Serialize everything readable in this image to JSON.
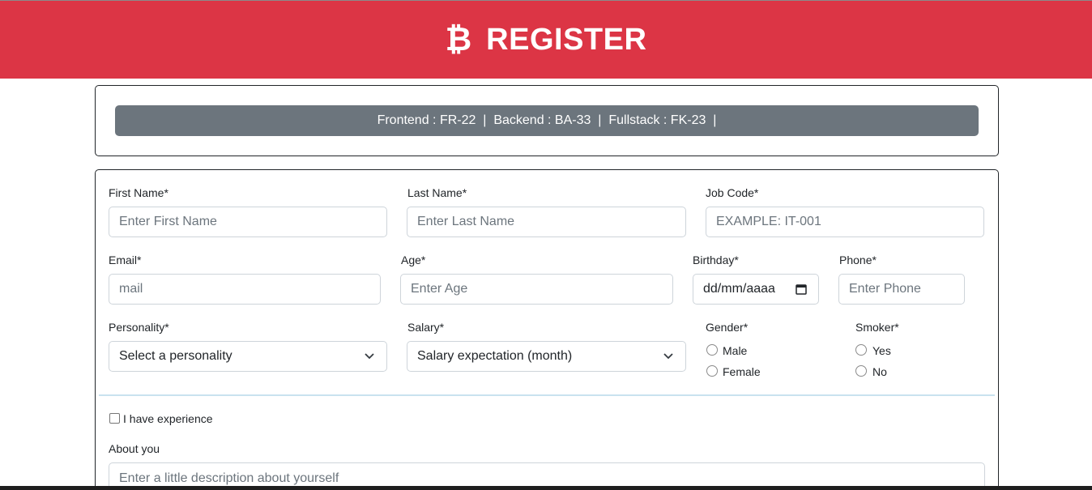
{
  "header": {
    "logo_glyph": "₿",
    "title": "REGISTER"
  },
  "job_codes": {
    "text": "Frontend : FR-22  |  Backend : BA-33  |  Fullstack : FK-23  |"
  },
  "form": {
    "first_name": {
      "label": "First Name*",
      "placeholder": "Enter First Name"
    },
    "last_name": {
      "label": "Last Name*",
      "placeholder": "Enter Last Name"
    },
    "job_code": {
      "label": "Job Code*",
      "placeholder": "EXAMPLE: IT-001"
    },
    "email": {
      "label": "Email*",
      "placeholder": "mail"
    },
    "age": {
      "label": "Age*",
      "placeholder": "Enter Age"
    },
    "birthday": {
      "label": "Birthday*",
      "value": "dd/mm/aaaa"
    },
    "phone": {
      "label": "Phone*",
      "placeholder": "Enter Phone"
    },
    "personality": {
      "label": "Personality*",
      "selected": "Select a personality"
    },
    "salary": {
      "label": "Salary*",
      "selected": "Salary expectation (month)"
    },
    "gender": {
      "label": "Gender*",
      "options": [
        "Male",
        "Female"
      ]
    },
    "smoker": {
      "label": "Smoker*",
      "options": [
        "Yes",
        "No"
      ]
    },
    "experience": {
      "label": "I have experience",
      "checked": false
    },
    "about": {
      "label": "About you",
      "placeholder": "Enter a little description about yourself"
    }
  },
  "colors": {
    "header_bg": "#dc3545",
    "codes_bg": "#6c757d",
    "divider": "#c9e2ef"
  }
}
